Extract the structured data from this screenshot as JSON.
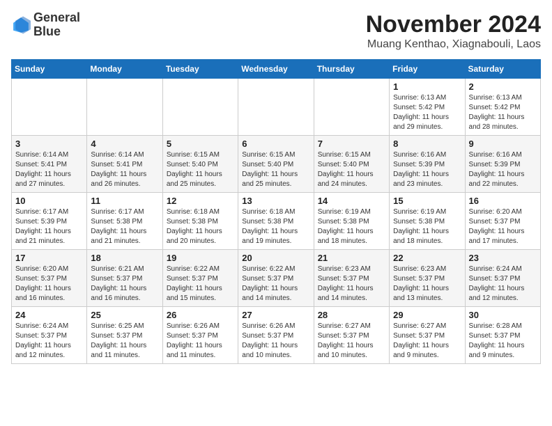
{
  "logo": {
    "line1": "General",
    "line2": "Blue"
  },
  "title": "November 2024",
  "subtitle": "Muang Kenthao, Xiagnabouli, Laos",
  "days_of_week": [
    "Sunday",
    "Monday",
    "Tuesday",
    "Wednesday",
    "Thursday",
    "Friday",
    "Saturday"
  ],
  "weeks": [
    [
      {
        "day": "",
        "info": ""
      },
      {
        "day": "",
        "info": ""
      },
      {
        "day": "",
        "info": ""
      },
      {
        "day": "",
        "info": ""
      },
      {
        "day": "",
        "info": ""
      },
      {
        "day": "1",
        "info": "Sunrise: 6:13 AM\nSunset: 5:42 PM\nDaylight: 11 hours and 29 minutes."
      },
      {
        "day": "2",
        "info": "Sunrise: 6:13 AM\nSunset: 5:42 PM\nDaylight: 11 hours and 28 minutes."
      }
    ],
    [
      {
        "day": "3",
        "info": "Sunrise: 6:14 AM\nSunset: 5:41 PM\nDaylight: 11 hours and 27 minutes."
      },
      {
        "day": "4",
        "info": "Sunrise: 6:14 AM\nSunset: 5:41 PM\nDaylight: 11 hours and 26 minutes."
      },
      {
        "day": "5",
        "info": "Sunrise: 6:15 AM\nSunset: 5:40 PM\nDaylight: 11 hours and 25 minutes."
      },
      {
        "day": "6",
        "info": "Sunrise: 6:15 AM\nSunset: 5:40 PM\nDaylight: 11 hours and 25 minutes."
      },
      {
        "day": "7",
        "info": "Sunrise: 6:15 AM\nSunset: 5:40 PM\nDaylight: 11 hours and 24 minutes."
      },
      {
        "day": "8",
        "info": "Sunrise: 6:16 AM\nSunset: 5:39 PM\nDaylight: 11 hours and 23 minutes."
      },
      {
        "day": "9",
        "info": "Sunrise: 6:16 AM\nSunset: 5:39 PM\nDaylight: 11 hours and 22 minutes."
      }
    ],
    [
      {
        "day": "10",
        "info": "Sunrise: 6:17 AM\nSunset: 5:39 PM\nDaylight: 11 hours and 21 minutes."
      },
      {
        "day": "11",
        "info": "Sunrise: 6:17 AM\nSunset: 5:38 PM\nDaylight: 11 hours and 21 minutes."
      },
      {
        "day": "12",
        "info": "Sunrise: 6:18 AM\nSunset: 5:38 PM\nDaylight: 11 hours and 20 minutes."
      },
      {
        "day": "13",
        "info": "Sunrise: 6:18 AM\nSunset: 5:38 PM\nDaylight: 11 hours and 19 minutes."
      },
      {
        "day": "14",
        "info": "Sunrise: 6:19 AM\nSunset: 5:38 PM\nDaylight: 11 hours and 18 minutes."
      },
      {
        "day": "15",
        "info": "Sunrise: 6:19 AM\nSunset: 5:38 PM\nDaylight: 11 hours and 18 minutes."
      },
      {
        "day": "16",
        "info": "Sunrise: 6:20 AM\nSunset: 5:37 PM\nDaylight: 11 hours and 17 minutes."
      }
    ],
    [
      {
        "day": "17",
        "info": "Sunrise: 6:20 AM\nSunset: 5:37 PM\nDaylight: 11 hours and 16 minutes."
      },
      {
        "day": "18",
        "info": "Sunrise: 6:21 AM\nSunset: 5:37 PM\nDaylight: 11 hours and 16 minutes."
      },
      {
        "day": "19",
        "info": "Sunrise: 6:22 AM\nSunset: 5:37 PM\nDaylight: 11 hours and 15 minutes."
      },
      {
        "day": "20",
        "info": "Sunrise: 6:22 AM\nSunset: 5:37 PM\nDaylight: 11 hours and 14 minutes."
      },
      {
        "day": "21",
        "info": "Sunrise: 6:23 AM\nSunset: 5:37 PM\nDaylight: 11 hours and 14 minutes."
      },
      {
        "day": "22",
        "info": "Sunrise: 6:23 AM\nSunset: 5:37 PM\nDaylight: 11 hours and 13 minutes."
      },
      {
        "day": "23",
        "info": "Sunrise: 6:24 AM\nSunset: 5:37 PM\nDaylight: 11 hours and 12 minutes."
      }
    ],
    [
      {
        "day": "24",
        "info": "Sunrise: 6:24 AM\nSunset: 5:37 PM\nDaylight: 11 hours and 12 minutes."
      },
      {
        "day": "25",
        "info": "Sunrise: 6:25 AM\nSunset: 5:37 PM\nDaylight: 11 hours and 11 minutes."
      },
      {
        "day": "26",
        "info": "Sunrise: 6:26 AM\nSunset: 5:37 PM\nDaylight: 11 hours and 11 minutes."
      },
      {
        "day": "27",
        "info": "Sunrise: 6:26 AM\nSunset: 5:37 PM\nDaylight: 11 hours and 10 minutes."
      },
      {
        "day": "28",
        "info": "Sunrise: 6:27 AM\nSunset: 5:37 PM\nDaylight: 11 hours and 10 minutes."
      },
      {
        "day": "29",
        "info": "Sunrise: 6:27 AM\nSunset: 5:37 PM\nDaylight: 11 hours and 9 minutes."
      },
      {
        "day": "30",
        "info": "Sunrise: 6:28 AM\nSunset: 5:37 PM\nDaylight: 11 hours and 9 minutes."
      }
    ]
  ]
}
